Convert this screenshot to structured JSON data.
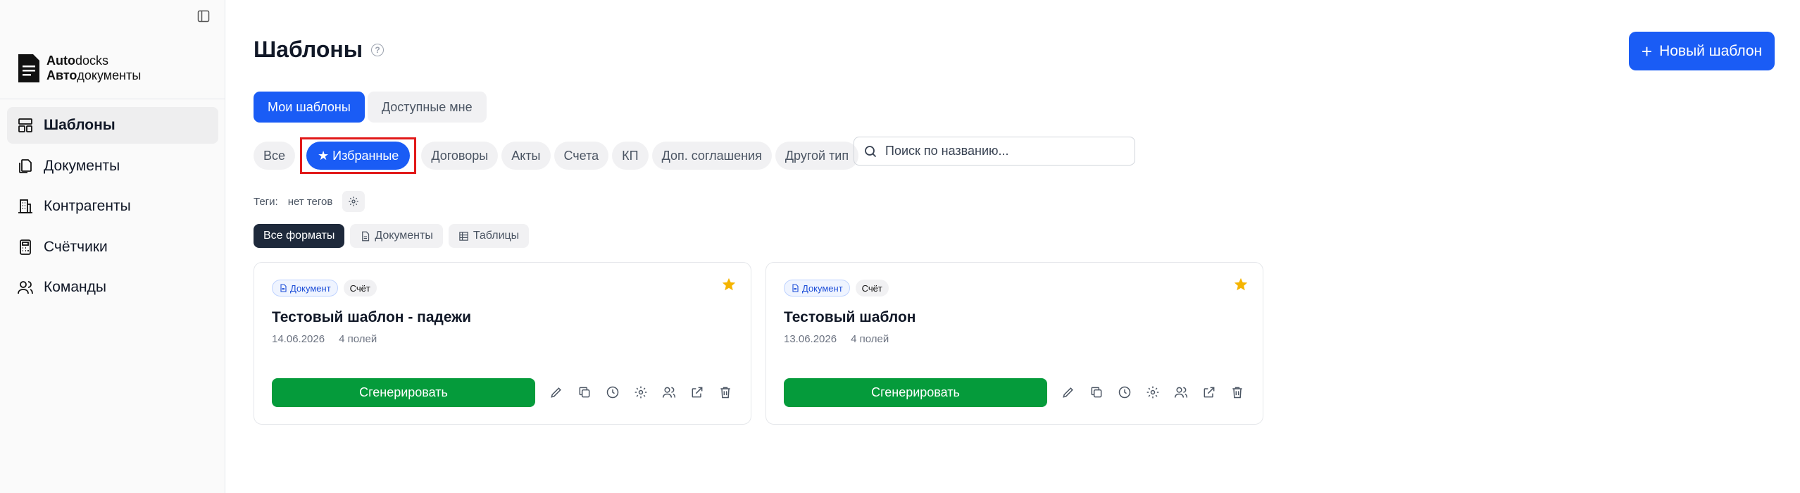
{
  "sidebar": {
    "logo": {
      "line1_bold": "Auto",
      "line1_rest": "docks",
      "line2_bold": "Авто",
      "line2_rest": "документы"
    },
    "items": [
      {
        "label": "Шаблоны",
        "icon": "layout-icon",
        "active": true
      },
      {
        "label": "Документы",
        "icon": "files-icon",
        "active": false
      },
      {
        "label": "Контрагенты",
        "icon": "building-icon",
        "active": false
      },
      {
        "label": "Счётчики",
        "icon": "calculator-icon",
        "active": false
      },
      {
        "label": "Команды",
        "icon": "users-icon",
        "active": false
      }
    ]
  },
  "header": {
    "title": "Шаблоны",
    "help": "?",
    "new_template": "Новый шаблон"
  },
  "tabs": [
    {
      "label": "Мои шаблоны",
      "active": true
    },
    {
      "label": "Доступные мне",
      "active": false
    }
  ],
  "filters": {
    "all": "Все",
    "favorites": "★ Избранные",
    "contracts": "Договоры",
    "acts": "Акты",
    "invoices": "Счета",
    "kp": "КП",
    "supplements": "Доп. соглашения",
    "other": "Другой тип"
  },
  "search": {
    "placeholder": "Поиск по названию..."
  },
  "tags": {
    "label": "Теги:",
    "value": "нет тегов"
  },
  "formats": {
    "all": "Все форматы",
    "documents": "Документы",
    "tables": "Таблицы"
  },
  "cards": [
    {
      "type_badge": "Документ",
      "category_badge": "Счёт",
      "title": "Тестовый шаблон - падежи",
      "date": "14.06.2026",
      "fields": "4 полей",
      "generate": "Сгенерировать",
      "favorite": true
    },
    {
      "type_badge": "Документ",
      "category_badge": "Счёт",
      "title": "Тестовый шаблон",
      "date": "13.06.2026",
      "fields": "4 полей",
      "generate": "Сгенерировать",
      "favorite": true
    }
  ],
  "colors": {
    "accent": "#1a5cf5",
    "generate": "#059b3b",
    "star": "#f5b400",
    "highlight": "#e11919"
  }
}
